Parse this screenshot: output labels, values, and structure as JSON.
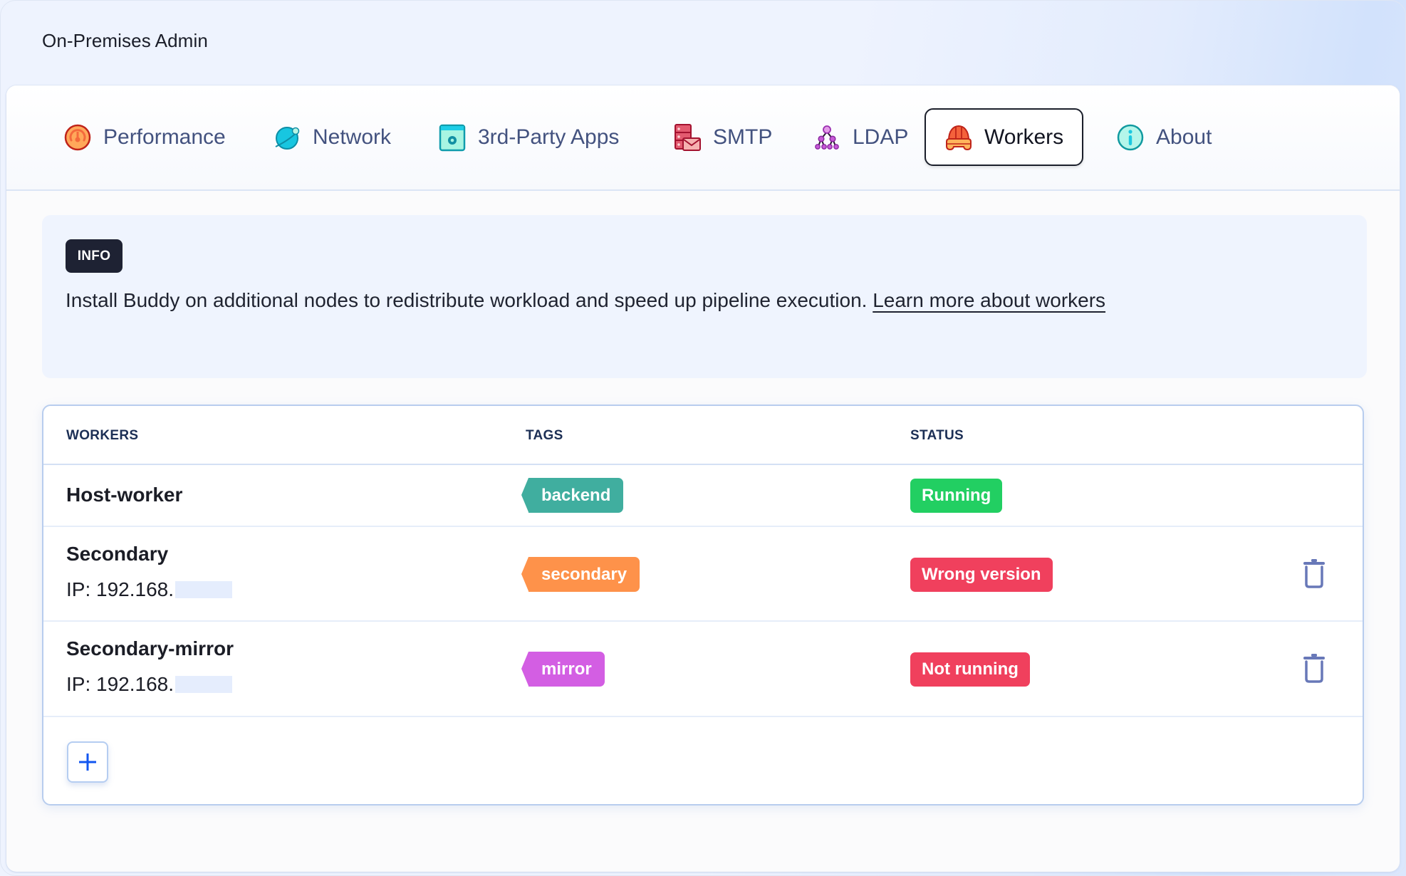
{
  "app": {
    "title": "On-Premises Admin"
  },
  "tabs": [
    {
      "label": "Performance",
      "icon": "gauge-icon",
      "active": false
    },
    {
      "label": "Network",
      "icon": "planet-icon",
      "active": false
    },
    {
      "label": "3rd-Party Apps",
      "icon": "app-gear-icon",
      "active": false
    },
    {
      "label": "SMTP",
      "icon": "server-mail-icon",
      "active": false
    },
    {
      "label": "LDAP",
      "icon": "hierarchy-icon",
      "active": false
    },
    {
      "label": "Workers",
      "icon": "worker-helmet-icon",
      "active": true
    },
    {
      "label": "About",
      "icon": "info-circle-icon",
      "active": false
    }
  ],
  "info": {
    "badge": "INFO",
    "text": "Install Buddy on additional nodes to redistribute workload and speed up pipeline execution. ",
    "link_label": "Learn more about workers"
  },
  "table": {
    "headers": {
      "workers": "WORKERS",
      "tags": "TAGS",
      "status": "STATUS"
    },
    "rows": [
      {
        "name": "Host-worker",
        "ip": "",
        "tag": "backend",
        "tag_color": "#40ae9f",
        "status": "Running",
        "status_color": "#22cf62",
        "deletable": false
      },
      {
        "name": "Secondary",
        "ip": "IP: 192.168.",
        "tag": "secondary",
        "tag_color": "#fe924a",
        "status": "Wrong version",
        "status_color": "#f0405d",
        "deletable": true
      },
      {
        "name": "Secondary-mirror",
        "ip": "IP: 192.168.",
        "tag": "mirror",
        "tag_color": "#d35ee3",
        "status": "Not running",
        "status_color": "#f0405d",
        "deletable": true
      }
    ],
    "add_button_label": "+"
  }
}
